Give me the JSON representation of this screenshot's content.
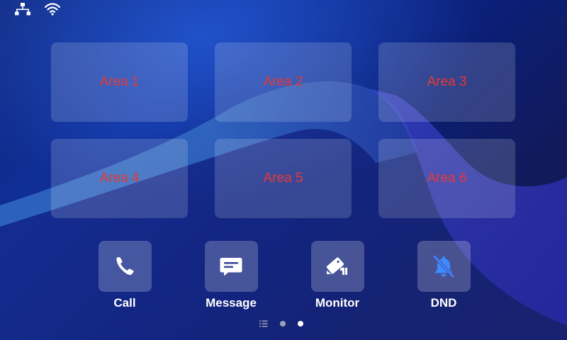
{
  "colors": {
    "tile_label": "#e53935",
    "icon_white": "#ffffff",
    "dnd_icon": "#3d8bff",
    "dot_inactive": "#9aa0b8",
    "dot_active": "#ffffff"
  },
  "status_bar": {
    "icons": [
      "network-icon",
      "wifi-icon"
    ]
  },
  "areas": [
    {
      "label": "Area 1"
    },
    {
      "label": "Area 2"
    },
    {
      "label": "Area 3"
    },
    {
      "label": "Area 4"
    },
    {
      "label": "Area 5"
    },
    {
      "label": "Area 6"
    }
  ],
  "actions": [
    {
      "label": "Call",
      "icon": "phone-icon"
    },
    {
      "label": "Message",
      "icon": "message-icon"
    },
    {
      "label": "Monitor",
      "icon": "camera-icon"
    },
    {
      "label": "DND",
      "icon": "bell-off-icon"
    }
  ],
  "pager": {
    "icons": [
      "list-icon"
    ],
    "page_count": 2,
    "current_page": 2
  }
}
